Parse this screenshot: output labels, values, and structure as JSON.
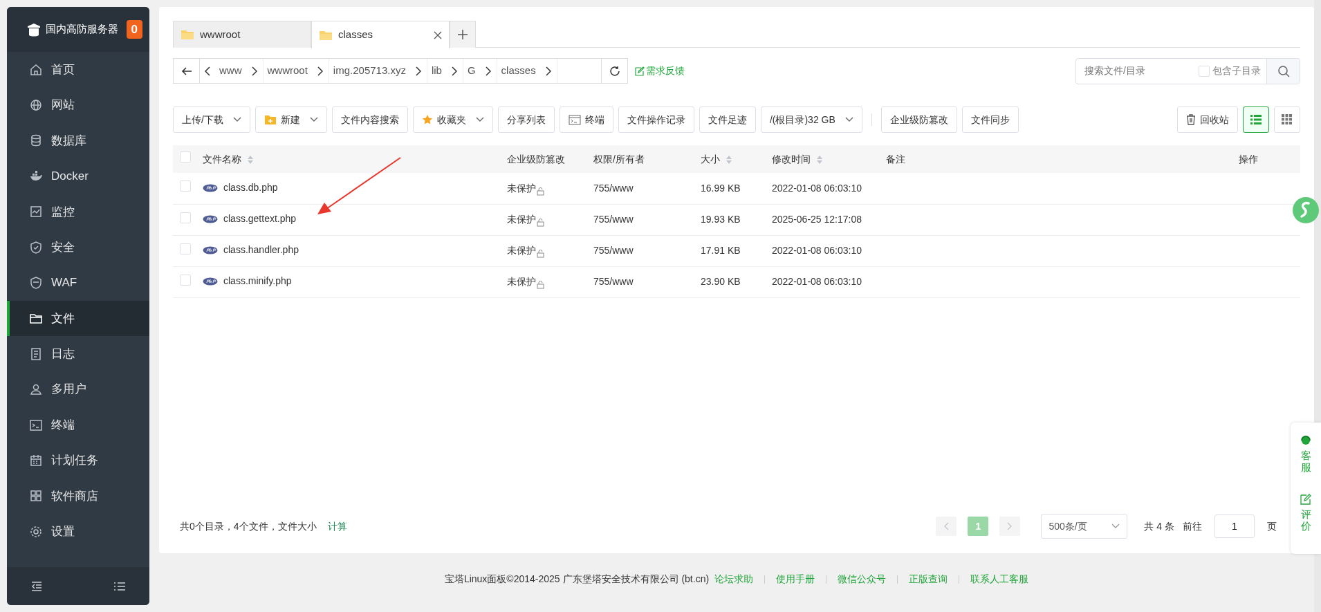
{
  "sidebar": {
    "brand": "国内高防服务器",
    "badge": "0",
    "items": [
      {
        "label": "首页",
        "kind": "home",
        "selected": false
      },
      {
        "label": "网站",
        "kind": "globe",
        "selected": false
      },
      {
        "label": "数据库",
        "kind": "db",
        "selected": false
      },
      {
        "label": "Docker",
        "kind": "docker",
        "selected": false
      },
      {
        "label": "监控",
        "kind": "monitor",
        "selected": false
      },
      {
        "label": "安全",
        "kind": "shield",
        "selected": false
      },
      {
        "label": "WAF",
        "kind": "waf",
        "selected": false
      },
      {
        "label": "文件",
        "kind": "folder",
        "selected": true
      },
      {
        "label": "日志",
        "kind": "log",
        "selected": false
      },
      {
        "label": "多用户",
        "kind": "users",
        "selected": false
      },
      {
        "label": "终端",
        "kind": "terminal",
        "selected": false
      },
      {
        "label": "计划任务",
        "kind": "calendar",
        "selected": false
      },
      {
        "label": "软件商店",
        "kind": "apps",
        "selected": false
      },
      {
        "label": "设置",
        "kind": "gear",
        "selected": false
      }
    ]
  },
  "tabs": [
    {
      "label": "wwwroot",
      "selected": false
    },
    {
      "label": "classes",
      "selected": true
    }
  ],
  "breadcrumb": [
    "www",
    "wwwroot",
    "img.205713.xyz",
    "lib",
    "G",
    "classes"
  ],
  "feedback_link": "需求反馈",
  "search": {
    "placeholder": "搜索文件/目录",
    "include_sub": {
      "label": "包含子目录",
      "checked": false
    }
  },
  "toolbar": [
    {
      "label": "上传/下载",
      "kind": "plain",
      "dropdown": true
    },
    {
      "label": "新建",
      "kind": "new",
      "dropdown": true
    },
    {
      "label": "文件内容搜索",
      "kind": "plain",
      "dropdown": false
    },
    {
      "label": "收藏夹",
      "kind": "star",
      "dropdown": true
    },
    {
      "label": "分享列表",
      "kind": "plain",
      "dropdown": false
    },
    {
      "label": "终端",
      "kind": "terminal",
      "dropdown": false
    },
    {
      "label": "文件操作记录",
      "kind": "plain",
      "dropdown": false
    },
    {
      "label": "文件足迹",
      "kind": "plain",
      "dropdown": false
    },
    {
      "label": "/(根目录)32 GB",
      "kind": "plain",
      "dropdown": true
    },
    {
      "label": "企业级防篡改",
      "kind": "plain",
      "dropdown": false,
      "separated": true
    },
    {
      "label": "文件同步",
      "kind": "plain",
      "dropdown": false,
      "separated": false
    }
  ],
  "recycle_button": "回收站",
  "views": [
    {
      "kind": "list",
      "selected": true
    },
    {
      "kind": "grid",
      "selected": false
    }
  ],
  "table": {
    "select_all_checked": false,
    "columns": [
      {
        "label": "文件名称",
        "sortable": true
      },
      {
        "label": "企业级防篡改",
        "sortable": false
      },
      {
        "label": "权限/所有者",
        "sortable": false
      },
      {
        "label": "大小",
        "sortable": true
      },
      {
        "label": "修改时间",
        "sortable": true
      },
      {
        "label": "备注",
        "sortable": false
      },
      {
        "label": "操作",
        "sortable": false
      }
    ],
    "rows": [
      {
        "name": "class.db.php",
        "protect": "未保护",
        "perm": "755/www",
        "size": "16.99 KB",
        "mtime": "2022-01-08 06:03:10",
        "checked": false
      },
      {
        "name": "class.gettext.php",
        "protect": "未保护",
        "perm": "755/www",
        "size": "19.93 KB",
        "mtime": "2025-06-25 12:17:08",
        "checked": false
      },
      {
        "name": "class.handler.php",
        "protect": "未保护",
        "perm": "755/www",
        "size": "17.91 KB",
        "mtime": "2022-01-08 06:03:10",
        "checked": false
      },
      {
        "name": "class.minify.php",
        "protect": "未保护",
        "perm": "755/www",
        "size": "23.90 KB",
        "mtime": "2022-01-08 06:03:10",
        "checked": false
      }
    ]
  },
  "summary": {
    "text": "共0个目录，4个文件，文件大小",
    "link": "计算"
  },
  "pagination": {
    "pages": [
      {
        "label": "1",
        "selected": true
      }
    ],
    "page_size": "500条/页",
    "total": "共 4 条",
    "goto": "前往",
    "page_input": "1",
    "page_unit": "页"
  },
  "footer": {
    "copyright": "宝塔Linux面板©2014-2025 广东堡塔安全技术有限公司 (bt.cn)",
    "links": [
      "论坛求助",
      "使用手册",
      "微信公众号",
      "正版查询",
      "联系人工客服"
    ]
  },
  "side_widget": [
    {
      "label": "客服",
      "kind": "headset"
    },
    {
      "label": "评价",
      "kind": "edit"
    }
  ]
}
